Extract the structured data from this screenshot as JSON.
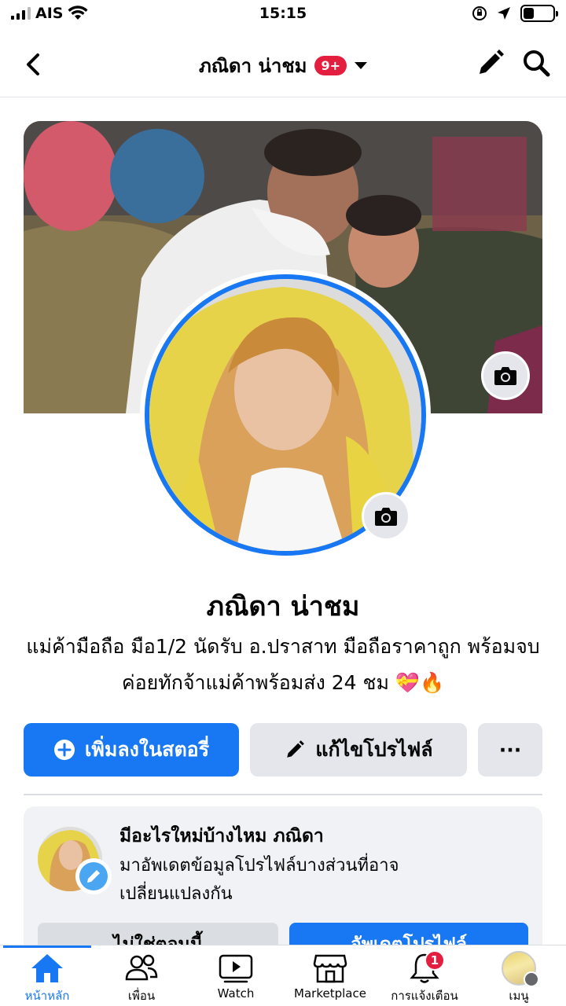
{
  "status_bar": {
    "carrier": "AIS",
    "time": "15:15",
    "icons": [
      "signal-icon",
      "wifi-icon",
      "orientation-lock-icon",
      "location-icon",
      "battery-icon"
    ],
    "battery_level": 0.35
  },
  "nav": {
    "title": "ภณิดา น่าชม",
    "badge": "9+",
    "icons": [
      "back-arrow-icon",
      "chevron-down-icon",
      "pencil-icon",
      "search-icon"
    ]
  },
  "profile": {
    "name": "ภณิดา น่าชม",
    "bio": "แม่ค้ามือถือ มือ1/2 นัดรับ อ.ปราสาท มือถือราคาถูก พร้อมจบค่อยทักจ้าแม่ค้าพร้อมส่ง 24 ชม 💝🔥"
  },
  "actions": {
    "add_story": "เพิ่มลงในสตอรี่",
    "edit_profile": "แก้ไขโปรไฟล์",
    "more": "···"
  },
  "prompt_card": {
    "title": "มีอะไรใหม่บ้างไหม ภณิดา",
    "description": "มาอัพเดตข้อมูลโปรไฟล์บางส่วนที่อาจเปลี่ยนแปลงกัน",
    "decline_button": "ไม่ใช่ตอนนี้",
    "update_button": "อัพเดตโปรไฟล์"
  },
  "tab_bar": {
    "tabs": [
      {
        "label": "หน้าหลัก",
        "icon": "home-icon",
        "active": true
      },
      {
        "label": "เพื่อน",
        "icon": "friends-icon"
      },
      {
        "label": "Watch",
        "icon": "watch-icon"
      },
      {
        "label": "Marketplace",
        "icon": "marketplace-icon"
      },
      {
        "label": "การแจ้งเตือน",
        "icon": "bell-icon",
        "badge": "1"
      },
      {
        "label": "เมนู",
        "icon": "menu-avatar-icon"
      }
    ]
  },
  "colors": {
    "accent": "#1877f2",
    "badge": "#e41e3f",
    "secondary_button": "#e4e6eb"
  }
}
